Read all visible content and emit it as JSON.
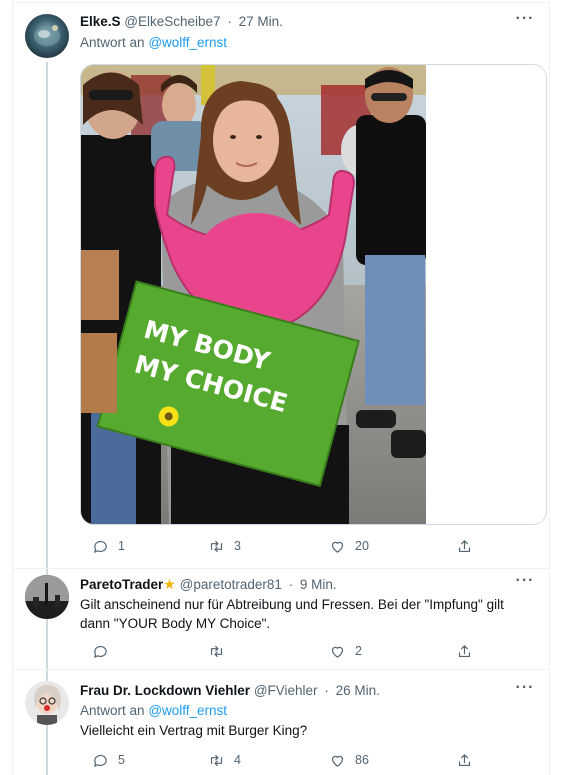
{
  "tweets": [
    {
      "name": "Elke.S",
      "handle": "@ElkeScheibe7",
      "time": "27 Min.",
      "reply_prefix": "Antwort an",
      "reply_to": "@wolff_ernst",
      "image_sign_text": [
        "MY BODY",
        "MY CHOICE"
      ],
      "actions": {
        "reply": "1",
        "retweet": "3",
        "like": "20"
      }
    },
    {
      "name": "ParetoTrader",
      "name_badge": "★",
      "handle": "@paretotrader81",
      "time": "9 Min.",
      "text": "Gilt anscheinend nur für Abtreibung und Fressen. Bei der \"Impfung\" gilt dann \"YOUR Body MY Choice\".",
      "actions": {
        "reply": "",
        "retweet": "",
        "like": "2"
      }
    },
    {
      "name": "Frau Dr. Lockdown Viehler",
      "handle": "@FViehler",
      "time": "26 Min.",
      "reply_prefix": "Antwort an",
      "reply_to": "@wolff_ernst",
      "text": "Vielleicht ein Vertrag mit Burger King?",
      "actions": {
        "reply": "5",
        "retweet": "4",
        "like": "86"
      }
    }
  ],
  "separator_dot": "·",
  "more_glyph": "···",
  "icons": [
    "reply-icon",
    "retweet-icon",
    "like-icon",
    "share-icon",
    "more-icon"
  ],
  "colors": {
    "link": "#1d9bf0",
    "secondary": "#536471",
    "border": "#eff3f4",
    "thread_line": "#cfd9de"
  }
}
